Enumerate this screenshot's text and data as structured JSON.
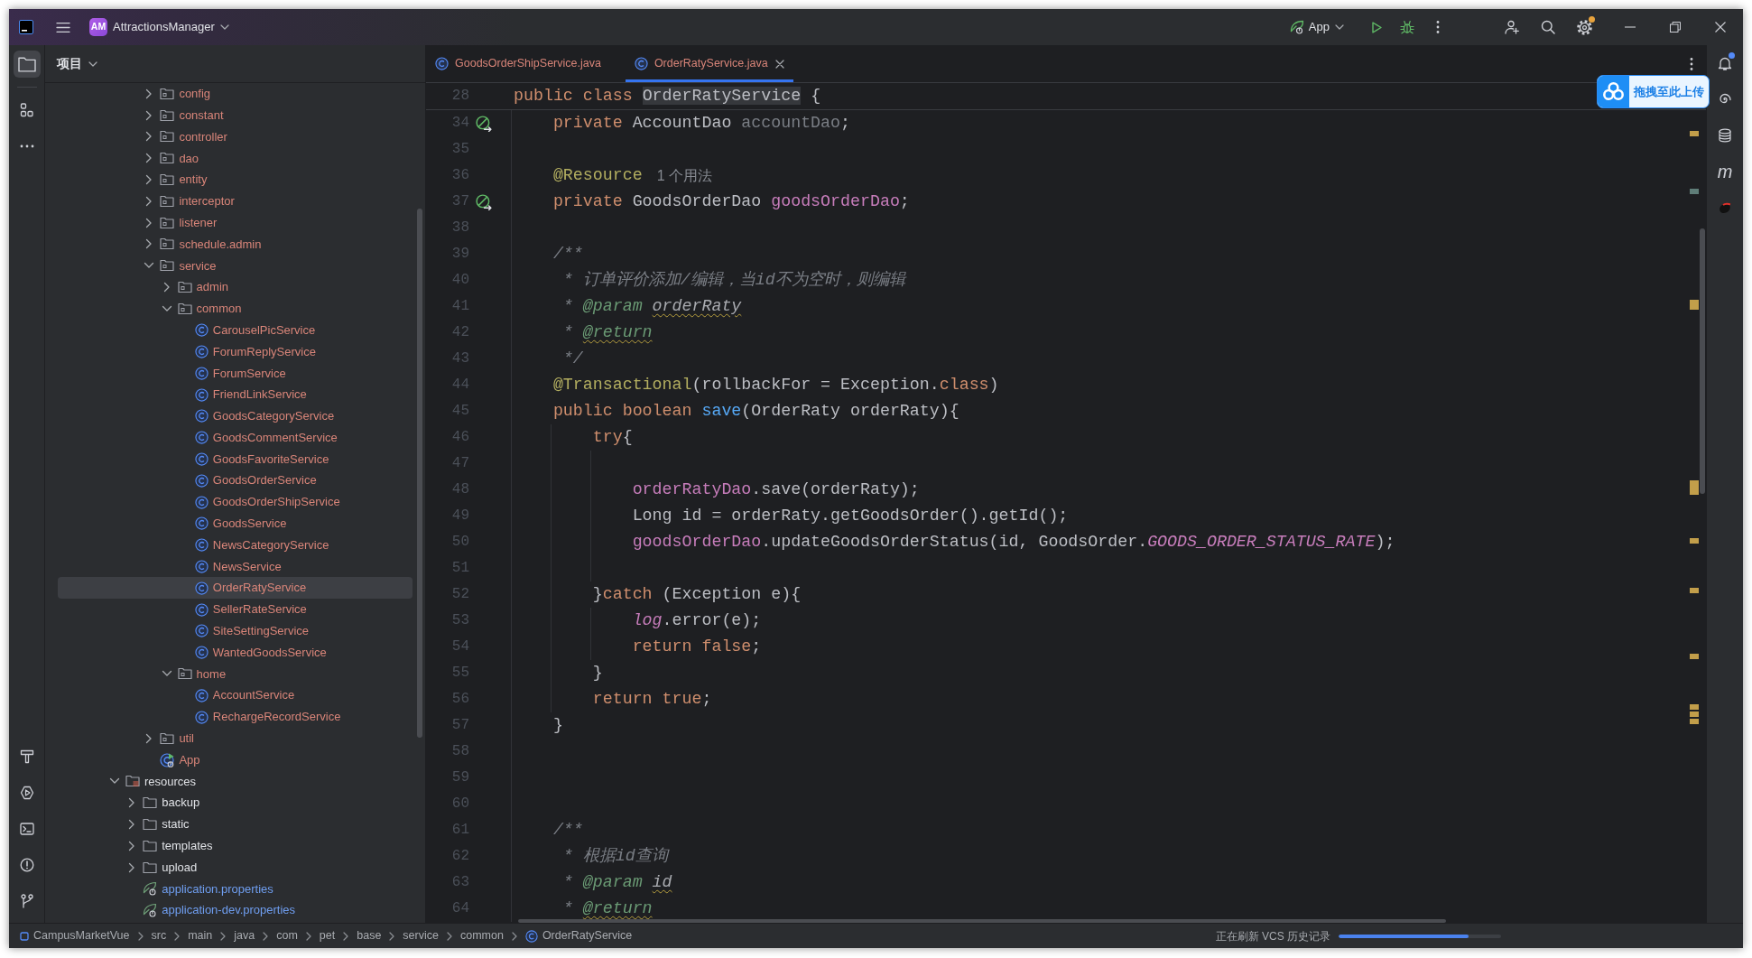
{
  "title_bar": {
    "project_badge": "AM",
    "project_name": "AttractionsManager",
    "run_config": "App",
    "actions": [
      {
        "kind": "run",
        "badge": false
      },
      {
        "kind": "debug",
        "badge": false
      },
      {
        "kind": "more",
        "badge": false
      },
      {
        "kind": "collaborate",
        "badge": false
      },
      {
        "kind": "search",
        "badge": false
      },
      {
        "kind": "settings",
        "badge": true
      }
    ]
  },
  "left_toolbar": {
    "top": [
      {
        "kind": "project",
        "selected": true
      },
      {
        "kind": "structure",
        "selected": false
      },
      {
        "kind": "more",
        "selected": false
      }
    ],
    "bottom": [
      {
        "kind": "build",
        "selected": false
      },
      {
        "kind": "run",
        "selected": false
      },
      {
        "kind": "terminal",
        "selected": false
      },
      {
        "kind": "problems",
        "selected": false
      },
      {
        "kind": "git",
        "selected": false
      }
    ]
  },
  "project_panel": {
    "title": "项目",
    "tree": [
      {
        "children": [
          {
            "children": [
              {
                "label": "config",
                "kind": "package",
                "expanded": false,
                "selected": false,
                "color": "#d98579"
              },
              {
                "label": "constant",
                "kind": "package",
                "expanded": false,
                "selected": false,
                "color": "#d98579"
              },
              {
                "label": "controller",
                "kind": "package",
                "expanded": false,
                "selected": false,
                "color": "#d98579"
              },
              {
                "label": "dao",
                "kind": "package",
                "expanded": false,
                "selected": false,
                "color": "#d98579"
              },
              {
                "label": "entity",
                "kind": "package",
                "expanded": false,
                "selected": false,
                "color": "#d98579"
              },
              {
                "label": "interceptor",
                "kind": "package",
                "expanded": false,
                "selected": false,
                "color": "#d98579"
              },
              {
                "label": "listener",
                "kind": "package",
                "expanded": false,
                "selected": false,
                "color": "#d98579"
              },
              {
                "label": "schedule.admin",
                "kind": "package",
                "expanded": false,
                "selected": false,
                "color": "#d98579"
              },
              {
                "label": "service",
                "kind": "package",
                "expanded": true,
                "selected": false,
                "color": "#d98579",
                "children": [
                  {
                    "label": "admin",
                    "kind": "package",
                    "expanded": false,
                    "selected": false,
                    "color": "#d98579"
                  },
                  {
                    "label": "common",
                    "kind": "package",
                    "expanded": true,
                    "selected": false,
                    "color": "#d98579",
                    "children": [
                      {
                        "label": "CarouselPicService",
                        "kind": "class",
                        "selected": false,
                        "color": "#d98579"
                      },
                      {
                        "label": "ForumReplyService",
                        "kind": "class",
                        "selected": false,
                        "color": "#d98579"
                      },
                      {
                        "label": "ForumService",
                        "kind": "class",
                        "selected": false,
                        "color": "#d98579"
                      },
                      {
                        "label": "FriendLinkService",
                        "kind": "class",
                        "selected": false,
                        "color": "#d98579"
                      },
                      {
                        "label": "GoodsCategoryService",
                        "kind": "class",
                        "selected": false,
                        "color": "#d98579"
                      },
                      {
                        "label": "GoodsCommentService",
                        "kind": "class",
                        "selected": false,
                        "color": "#d98579"
                      },
                      {
                        "label": "GoodsFavoriteService",
                        "kind": "class",
                        "selected": false,
                        "color": "#d98579"
                      },
                      {
                        "label": "GoodsOrderService",
                        "kind": "class",
                        "selected": false,
                        "color": "#d98579"
                      },
                      {
                        "label": "GoodsOrderShipService",
                        "kind": "class",
                        "selected": false,
                        "color": "#d98579"
                      },
                      {
                        "label": "GoodsService",
                        "kind": "class",
                        "selected": false,
                        "color": "#d98579"
                      },
                      {
                        "label": "NewsCategoryService",
                        "kind": "class",
                        "selected": false,
                        "color": "#d98579"
                      },
                      {
                        "label": "NewsService",
                        "kind": "class",
                        "selected": false,
                        "color": "#d98579"
                      },
                      {
                        "label": "OrderRatyService",
                        "kind": "class",
                        "selected": true,
                        "color": "#d98579"
                      },
                      {
                        "label": "SellerRateService",
                        "kind": "class",
                        "selected": false,
                        "color": "#d98579"
                      },
                      {
                        "label": "SiteSettingService",
                        "kind": "class",
                        "selected": false,
                        "color": "#d98579"
                      },
                      {
                        "label": "WantedGoodsService",
                        "kind": "class",
                        "selected": false,
                        "color": "#d98579"
                      }
                    ]
                  },
                  {
                    "label": "home",
                    "kind": "package",
                    "expanded": true,
                    "selected": false,
                    "color": "#d98579",
                    "children": [
                      {
                        "label": "AccountService",
                        "kind": "class",
                        "selected": false,
                        "color": "#d98579"
                      },
                      {
                        "label": "RechargeRecordService",
                        "kind": "class",
                        "selected": false,
                        "color": "#d98579"
                      }
                    ]
                  }
                ]
              },
              {
                "label": "util",
                "kind": "package",
                "expanded": false,
                "selected": false,
                "color": "#d98579"
              },
              {
                "label": "App",
                "kind": "app",
                "selected": false,
                "color": "#d98579"
              }
            ]
          }
        ]
      },
      {
        "label": "resources",
        "kind": "resources",
        "expanded": true,
        "selected": false,
        "color": "#dfe1e5",
        "children": [
          {
            "label": "backup",
            "kind": "folder",
            "expanded": false,
            "selected": false,
            "color": "#dfe1e5"
          },
          {
            "label": "static",
            "kind": "folder",
            "expanded": false,
            "selected": false,
            "color": "#dfe1e5"
          },
          {
            "label": "templates",
            "kind": "folder",
            "expanded": false,
            "selected": false,
            "color": "#dfe1e5"
          },
          {
            "label": "upload",
            "kind": "folder",
            "expanded": false,
            "selected": false,
            "color": "#dfe1e5"
          },
          {
            "label": "application.properties",
            "kind": "properties",
            "selected": false,
            "color": "#6f9ef0"
          },
          {
            "label": "application-dev.properties",
            "kind": "properties",
            "selected": false,
            "color": "#6f9ef0"
          }
        ]
      }
    ]
  },
  "editor": {
    "tabs": [
      {
        "label": "GoodsOrderShipService.java",
        "selected": false,
        "color": "#d98579"
      },
      {
        "label": "OrderRatyService.java",
        "selected": true,
        "color": "#d98579"
      }
    ],
    "sticky_line": {
      "number": "28",
      "gutter_icon": false,
      "tokens": [
        {
          "text": "public class ",
          "kind": "keyword"
        },
        {
          "text": "OrderRatyService",
          "kind": "highlight"
        },
        {
          "text": " {",
          "kind": "plain"
        }
      ]
    },
    "lines": [
      {
        "number": "34",
        "gutter_icon": true,
        "tokens": [
          {
            "text": "    private ",
            "kind": "keyword"
          },
          {
            "text": "AccountDao ",
            "kind": "plain"
          },
          {
            "text": "accountDao",
            "kind": "unused"
          },
          {
            "text": ";",
            "kind": "plain"
          }
        ]
      },
      {
        "number": "35",
        "gutter_icon": false
      },
      {
        "number": "36",
        "gutter_icon": false,
        "tokens": [
          {
            "text": "    @Resource",
            "kind": "annotation"
          }
        ],
        "hint": "1 个用法"
      },
      {
        "number": "37",
        "gutter_icon": true,
        "tokens": [
          {
            "text": "    private ",
            "kind": "keyword"
          },
          {
            "text": "GoodsOrderDao ",
            "kind": "plain"
          },
          {
            "text": "goodsOrderDao",
            "kind": "field"
          },
          {
            "text": ";",
            "kind": "plain"
          }
        ]
      },
      {
        "number": "38",
        "gutter_icon": false
      },
      {
        "number": "39",
        "gutter_icon": false,
        "tokens": [
          {
            "text": "    /**",
            "kind": "comment"
          }
        ]
      },
      {
        "number": "40",
        "gutter_icon": false,
        "tokens": [
          {
            "text": "     * 订单评价添加/编辑，当id不为空时，则编辑",
            "kind": "comment"
          }
        ]
      },
      {
        "number": "41",
        "gutter_icon": false,
        "tokens": [
          {
            "text": "     * ",
            "kind": "comment"
          },
          {
            "text": "@param ",
            "kind": "doctag"
          },
          {
            "text": "orderRaty",
            "kind": "docref"
          }
        ]
      },
      {
        "number": "42",
        "gutter_icon": false,
        "tokens": [
          {
            "text": "     * ",
            "kind": "comment"
          },
          {
            "text": "@return",
            "kind": "doctag-warn"
          }
        ]
      },
      {
        "number": "43",
        "gutter_icon": false,
        "tokens": [
          {
            "text": "     */",
            "kind": "comment"
          }
        ]
      },
      {
        "number": "44",
        "gutter_icon": false,
        "tokens": [
          {
            "text": "    @Transactional",
            "kind": "annotation"
          },
          {
            "text": "(rollbackFor = Exception.",
            "kind": "plain"
          },
          {
            "text": "class",
            "kind": "keyword"
          },
          {
            "text": ")",
            "kind": "plain"
          }
        ]
      },
      {
        "number": "45",
        "gutter_icon": false,
        "tokens": [
          {
            "text": "    public boolean ",
            "kind": "keyword"
          },
          {
            "text": "save",
            "kind": "method"
          },
          {
            "text": "(OrderRaty orderRaty){",
            "kind": "plain"
          }
        ]
      },
      {
        "number": "46",
        "gutter_icon": false,
        "tokens": [
          {
            "text": "        try",
            "kind": "keyword"
          },
          {
            "text": "{",
            "kind": "plain"
          }
        ]
      },
      {
        "number": "47",
        "gutter_icon": false
      },
      {
        "number": "48",
        "gutter_icon": false,
        "tokens": [
          {
            "text": "            orderRatyDao",
            "kind": "field"
          },
          {
            "text": ".save(orderRaty);",
            "kind": "plain"
          }
        ]
      },
      {
        "number": "49",
        "gutter_icon": false,
        "tokens": [
          {
            "text": "            Long id = orderRaty.getGoodsOrder().getId();",
            "kind": "plain"
          }
        ]
      },
      {
        "number": "50",
        "gutter_icon": false,
        "tokens": [
          {
            "text": "            goodsOrderDao",
            "kind": "field"
          },
          {
            "text": ".updateGoodsOrderStatus(id, GoodsOrder.",
            "kind": "plain"
          },
          {
            "text": "GOODS_ORDER_STATUS_RATE",
            "kind": "constant"
          },
          {
            "text": ");",
            "kind": "plain"
          }
        ]
      },
      {
        "number": "51",
        "gutter_icon": false
      },
      {
        "number": "52",
        "gutter_icon": false,
        "tokens": [
          {
            "text": "        }",
            "kind": "plain"
          },
          {
            "text": "catch",
            "kind": "keyword"
          },
          {
            "text": " (Exception e){",
            "kind": "plain"
          }
        ]
      },
      {
        "number": "53",
        "gutter_icon": false,
        "tokens": [
          {
            "text": "            log",
            "kind": "static"
          },
          {
            "text": ".error(e);",
            "kind": "plain"
          }
        ]
      },
      {
        "number": "54",
        "gutter_icon": false,
        "tokens": [
          {
            "text": "            return false",
            "kind": "keyword"
          },
          {
            "text": ";",
            "kind": "plain"
          }
        ]
      },
      {
        "number": "55",
        "gutter_icon": false,
        "tokens": [
          {
            "text": "        }",
            "kind": "plain"
          }
        ]
      },
      {
        "number": "56",
        "gutter_icon": false,
        "tokens": [
          {
            "text": "        return true",
            "kind": "keyword"
          },
          {
            "text": ";",
            "kind": "plain"
          }
        ]
      },
      {
        "number": "57",
        "gutter_icon": false,
        "tokens": [
          {
            "text": "    }",
            "kind": "plain"
          }
        ]
      },
      {
        "number": "58",
        "gutter_icon": false
      },
      {
        "number": "59",
        "gutter_icon": false
      },
      {
        "number": "60",
        "gutter_icon": false
      },
      {
        "number": "61",
        "gutter_icon": false,
        "tokens": [
          {
            "text": "    /**",
            "kind": "comment"
          }
        ]
      },
      {
        "number": "62",
        "gutter_icon": false,
        "tokens": [
          {
            "text": "     * 根据id查询",
            "kind": "comment"
          }
        ]
      },
      {
        "number": "63",
        "gutter_icon": false,
        "tokens": [
          {
            "text": "     * ",
            "kind": "comment"
          },
          {
            "text": "@param ",
            "kind": "doctag"
          },
          {
            "text": "id",
            "kind": "docref"
          }
        ]
      },
      {
        "number": "64",
        "gutter_icon": false,
        "tokens": [
          {
            "text": "     * ",
            "kind": "comment"
          },
          {
            "text": "@return",
            "kind": "doctag-warn"
          }
        ]
      }
    ]
  },
  "right_toolbar": [
    {
      "kind": "notifications",
      "badge": true
    },
    {
      "kind": "assistant",
      "badge": false
    },
    {
      "kind": "database",
      "badge": false
    },
    {
      "kind": "maven",
      "glyph": "m",
      "badge": false
    },
    {
      "kind": "plugin",
      "badge": false
    }
  ],
  "upload_widget": {
    "label": "拖拽至此上传"
  },
  "status_bar": {
    "breadcrumbs": [
      {
        "label": "CampusMarketVue",
        "kind": "module"
      },
      {
        "label": "src",
        "kind": "folder"
      },
      {
        "label": "main",
        "kind": "folder"
      },
      {
        "label": "java",
        "kind": "folder"
      },
      {
        "label": "com",
        "kind": "folder"
      },
      {
        "label": "pet",
        "kind": "folder"
      },
      {
        "label": "base",
        "kind": "folder"
      },
      {
        "label": "service",
        "kind": "folder"
      },
      {
        "label": "common",
        "kind": "folder"
      },
      {
        "label": "OrderRatyService",
        "kind": "class"
      }
    ],
    "task": "正在刷新 VCS 历史记录",
    "progress": {
      "level": 0.8
    }
  }
}
